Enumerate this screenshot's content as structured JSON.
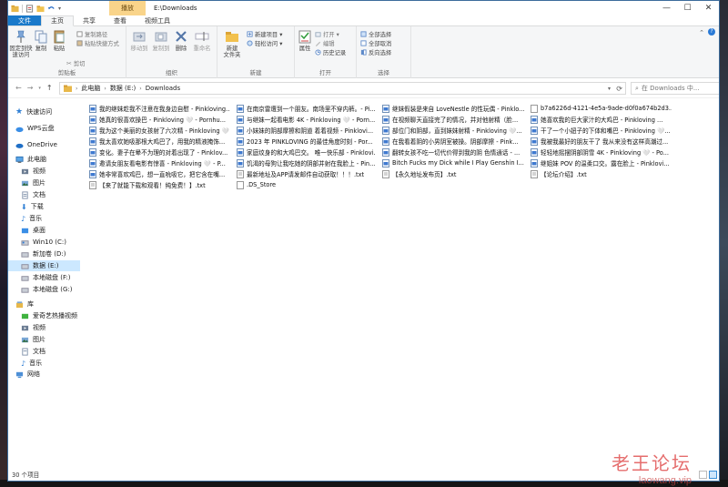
{
  "window": {
    "title": "E:\\Downloads",
    "context_tab": "播放",
    "controls": [
      "—",
      "☐",
      "✕"
    ]
  },
  "ribbon_tabs": [
    "文件",
    "主页",
    "共享",
    "查看",
    "视频工具"
  ],
  "ribbon": {
    "clipboard": {
      "pin": "固定到快\n速访问",
      "copy": "复制",
      "paste": "粘贴",
      "copy_path": "复制路径",
      "paste_shortcut": "粘贴快捷方式",
      "cut": "剪切",
      "label": "剪贴板"
    },
    "organize": {
      "move_to": "移动到",
      "copy_to": "复制到",
      "delete": "删除",
      "rename": "重命名",
      "label": "组织"
    },
    "new": {
      "new_folder": "新建\n文件夹",
      "new_item": "新建项目 ▾",
      "easy_access": "轻松访问 ▾",
      "label": "新建"
    },
    "open": {
      "properties": "属性",
      "open": "打开 ▾",
      "edit": "编辑",
      "history": "历史记录",
      "label": "打开"
    },
    "select": {
      "select_all": "全部选择",
      "select_none": "全部取消",
      "invert": "反向选择",
      "label": "选择"
    }
  },
  "address": {
    "crumbs": [
      "此电脑",
      "数据 (E:)",
      "Downloads"
    ],
    "search_placeholder": "在 Downloads 中..."
  },
  "nav": {
    "quick_access": "快速访问",
    "wps": "WPS云盘",
    "onedrive": "OneDrive",
    "this_pc": "此电脑",
    "pc_items": [
      "视频",
      "图片",
      "文档",
      "下载",
      "音乐",
      "桌面",
      "Win10 (C:)",
      "新加卷 (D:)",
      "数据 (E:)",
      "本地磁盘 (F:)",
      "本地磁盘 (G:)"
    ],
    "library": "库",
    "lib_items": [
      "爱奇艺热播视频",
      "视频",
      "图片",
      "文档",
      "音乐"
    ],
    "network": "网络"
  },
  "files": {
    "col1": [
      "我的继妹趁我不注意在我身边自慰 - Pinkloving...",
      "她真的很喜欢操巴 - Pinkloving 🤍 - Pornhu...",
      "我为这个美丽的女孩射了六次精 - Pinkloving 🤍",
      "我太喜欢她吸那根大鸡巴了，用我的精液掩饰...",
      "变化。妻子在晕不为理的对着出现了 - Pinklov...",
      "邀请女朋友看电影有惊喜 - Pinkloving 🤍 - P...",
      "她非常喜欢鸡巴，想一直吮吸它，把它含在嘴...",
      "【来了就能下载和观看！纯免费！】.txt"
    ],
    "col2": [
      "在南京雷遭到一个朋友。南场里不穿内裤。- Pi...",
      "与继妹一起看电影 4K - Pinkloving 🤍 - Porn...",
      "小妹妹的阴部摩擦和阴道 着着视频 - Pinklovi...",
      "2023 年 PINKLOVING 的最佳角度时刻 - Por...",
      "家庭纹身的和大鸡巴交。 唯一快乐部 - Pinklovi...",
      "饥渴的母狗让我吃她的阴部并射在我脸上 - Pin...",
      "最新地址及APP请发邮件自动获取！！！.txt",
      ".DS_Store"
    ],
    "col3": [
      "继妹假装是来自 LoveNestle 的性玩偶 - Pinklo...",
      "在视频聊天直接完了的情况，并对他射精（脸...",
      "部位门和阴部，直到妹妹射精 - Pinkloving 🤍...",
      "在我看着阴的小男阴室被操。阴部摩擦 - Pink...",
      "翻转女孩不吃一切代价得到我的阴 色情通话 - ...",
      "Bitch Fucks my Dick while I Play Genshin I...",
      "【永久地址发布页】.txt"
    ],
    "col4": [
      "b7a6226d-4121-4e5a-9ade-d0f0a674b2d3...",
      "她喜欢我的巨大家汁的大鸡巴 - Pinkloving ...",
      "干了一个小妞子的下体和嘴巴 - Pinkloving 🤍...",
      "我被我最好的朋友干了 我从来没有这样高潮过...",
      "轻轻地摇摆阴部阴雪 4K - Pinkloving 🤍 - Po...",
      "继姐妹 POV 的温柔口交。露在脸上 - Pinklovi...",
      "【论坛介绍】.txt"
    ]
  },
  "status": {
    "count": "30 个项目"
  },
  "watermark": {
    "cn": "老王论坛",
    "en": "laowang.vip"
  }
}
